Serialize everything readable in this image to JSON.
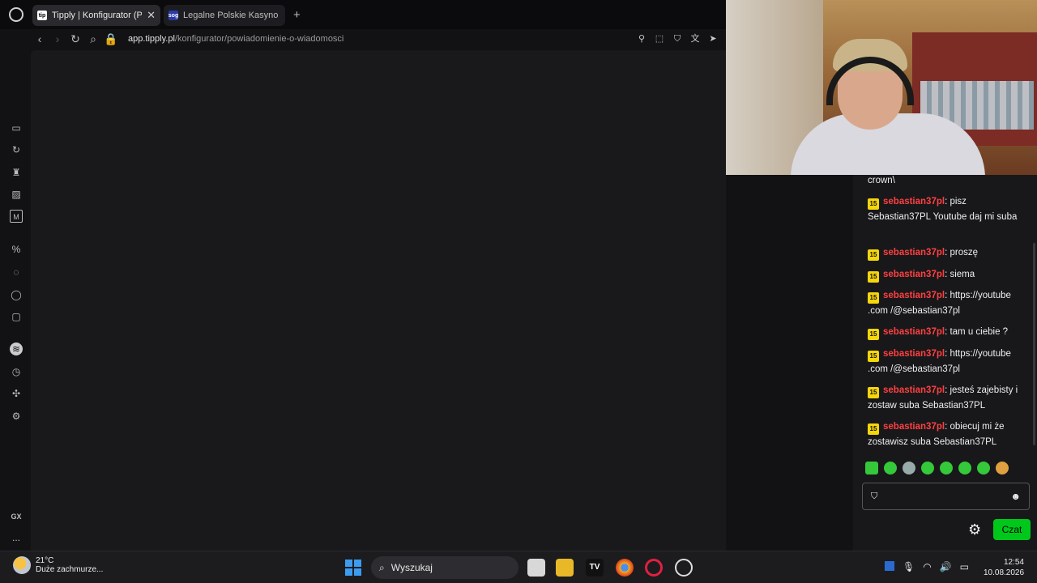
{
  "browser": {
    "tabs": [
      {
        "title": "Tipply | Konfigurator (P",
        "favicon": "tip",
        "active": true
      },
      {
        "title": "Legalne Polskie Kasyno Int",
        "favicon": "sog",
        "active": false
      }
    ],
    "url_host": "app.tipply.pl",
    "url_path": "/konfigurator/powiadomienie-o-wiadomosci"
  },
  "sidebar_icons": [
    "gaming-icon",
    "refresh-icon",
    "crown-icon",
    "layers-icon",
    "m-icon",
    "percent-icon",
    "messenger-icon",
    "whatsapp-icon",
    "instagram-icon",
    "spotify-icon",
    "history-icon",
    "extensions-icon",
    "settings-icon"
  ],
  "sidebar_bottom": {
    "gx_label": "GX",
    "more_label": "..."
  },
  "chat": {
    "cut_line": "crown\\",
    "messages": [
      {
        "badge": "15",
        "user": "sebastian37pl",
        "text": ": pisz Sebastian37PL Youtube daj mi suba"
      },
      {
        "badge": "15",
        "user": "sebastian37pl",
        "text": ": proszę"
      },
      {
        "badge": "15",
        "user": "sebastian37pl",
        "text": ": siema"
      },
      {
        "badge": "15",
        "user": "sebastian37pl",
        "text": ": https://youtube .com /@sebastian37pl"
      },
      {
        "badge": "15",
        "user": "sebastian37pl",
        "text": ": tam u ciebie ?"
      },
      {
        "badge": "15",
        "user": "sebastian37pl",
        "text": ": https://youtube .com /@sebastian37pl"
      },
      {
        "badge": "15",
        "user": "sebastian37pl",
        "text": ": jesteś zajebisty i zostaw suba Sebastian37PL"
      },
      {
        "badge": "15",
        "user": "sebastian37pl",
        "text": ": obiecuj mi że zostawisz suba Sebastian37PL"
      }
    ],
    "send_label": "Czat"
  },
  "taskbar": {
    "temp": "21°C",
    "weather": "Duże zachmurze...",
    "search_placeholder": "Wyszukaj",
    "time": "12:54",
    "date": "10.08.2026"
  },
  "colors": {
    "username": "#ff4040",
    "badge": "#f5d60c",
    "send_button": "#00c81a"
  }
}
